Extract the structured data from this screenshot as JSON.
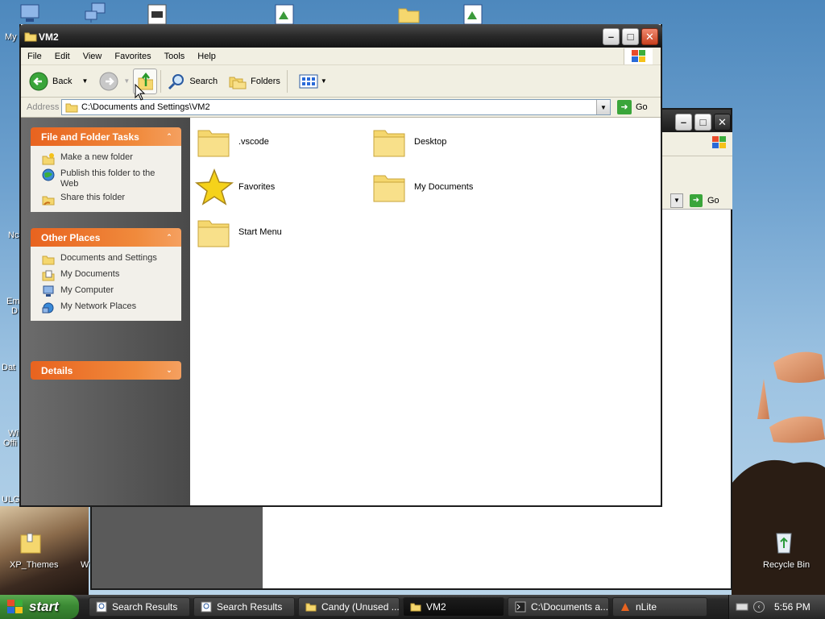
{
  "desktop": {
    "left_labels": [
      "My",
      "Nc",
      "Em",
      "D",
      "Dat",
      "Wi",
      "Offi",
      "ULG"
    ],
    "xp_themes_label": "XP_Themes",
    "partial_label_w": "W",
    "recycle_bin_label": "Recycle Bin"
  },
  "window": {
    "title": "VM2",
    "menu": [
      "File",
      "Edit",
      "View",
      "Favorites",
      "Tools",
      "Help"
    ],
    "toolbar": {
      "back": "Back",
      "search": "Search",
      "folders": "Folders"
    },
    "address_label": "Address",
    "address_value": "C:\\Documents and Settings\\VM2",
    "go_label": "Go",
    "tasks": {
      "title": "File and Folder Tasks",
      "items": [
        "Make a new folder",
        "Publish this folder to the Web",
        "Share this folder"
      ]
    },
    "other_places": {
      "title": "Other Places",
      "items": [
        "Documents and Settings",
        "My Documents",
        "My Computer",
        "My Network Places"
      ]
    },
    "details": {
      "title": "Details"
    },
    "files": [
      ".vscode",
      "Desktop",
      "Favorites",
      "My Documents",
      "Start Menu"
    ]
  },
  "back_window": {
    "go_label": "Go"
  },
  "taskbar": {
    "start_label": "start",
    "tasks": [
      "Search Results",
      "Search Results",
      "Candy (Unused ...",
      "VM2",
      "C:\\Documents a...",
      "nLite"
    ],
    "clock": "5:56 PM"
  },
  "colors": {
    "accent_orange": "#e8631f",
    "start_green": "#3b8a34",
    "folder_yellow": "#f5d76e"
  }
}
